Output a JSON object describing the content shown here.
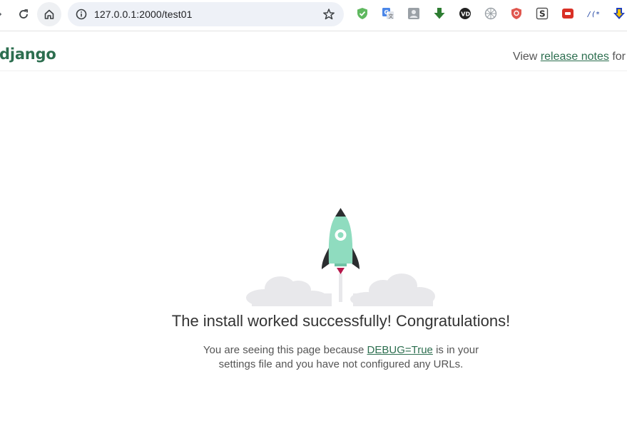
{
  "browser": {
    "url": "127.0.0.1:2000/test01",
    "extension_icons": [
      "shield-check-icon",
      "google-translate-icon",
      "profile-card-icon",
      "download-arrow-icon",
      "vd-icon",
      "network-icon",
      "vpn-shield-icon",
      "s-letter-icon",
      "screen-capture-icon",
      "dev-icon",
      "arrow-down-icon"
    ]
  },
  "header": {
    "logo": "django",
    "notes_prefix": "View ",
    "notes_link": "release notes",
    "notes_suffix": " for"
  },
  "main": {
    "title": "The install worked successfully! Congratulations!",
    "sub_prefix": "You are seeing this page because ",
    "sub_link": "DEBUG=True",
    "sub_line1_suffix": " is in your",
    "sub_line2": "settings file and you have not configured any URLs."
  },
  "colors": {
    "django_green": "#2c6e4f",
    "rocket_body": "#8fdcbf",
    "rocket_dark": "#333333",
    "cloud": "#e8e8eb"
  }
}
